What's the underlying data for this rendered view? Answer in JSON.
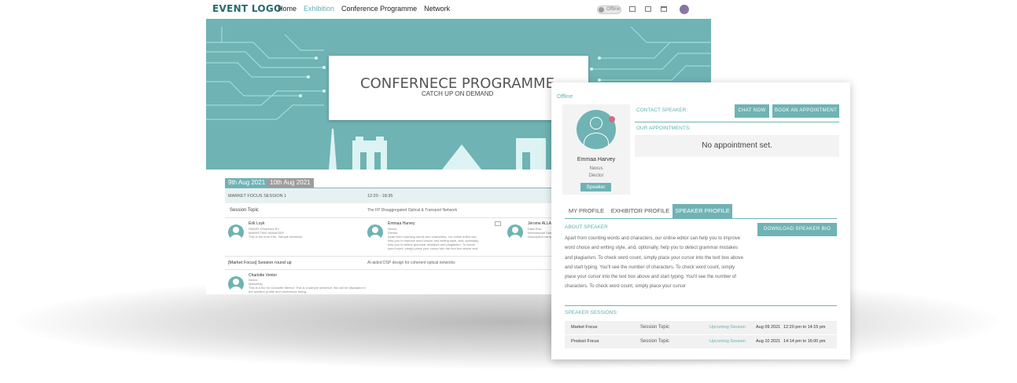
{
  "header": {
    "logo": "EVENT LOGO",
    "nav": [
      "Home",
      "Exhibition",
      "Conference Programme",
      "Network"
    ],
    "status_toggle": "Offline"
  },
  "hero": {
    "title": "CONFERNECE PROGRAMME",
    "subtitle": "CATCH UP ON DEMAND"
  },
  "schedule": {
    "dates": [
      "9th Aug 2021",
      "10th Aug 2021"
    ],
    "session1": {
      "title": "MARKET FOCUS SESSION 1",
      "time": "12:20 - 18:35",
      "topic_label": "Session Topic",
      "topic": "The FP Disaggregated Optical & Transport Network",
      "speakers": [
        {
          "name": "Erik Loyk",
          "company": "SMART Photonics BV",
          "role": "MARKETING MANAGER",
          "bio": "This is bio from Erik. Sample sentence."
        },
        {
          "name": "Emmaa Harvey",
          "company": "Nexus",
          "role": "Diector",
          "bio": "Apart from counting words and characters, our online editor can help you to improve word choice and writing style, and, optionally, help you to detect grammar mistakes and plagiarism. To check word count, simply place your cursor into the text box above and start typing. You'll see the number of characters."
        },
        {
          "name": "Jerome ALLANO",
          "company": "Data Rise",
          "role": "International Sales",
          "bio": "Description sample"
        }
      ]
    },
    "session2": {
      "title": "[Market Focus] Session round up",
      "topic": "AI-aided DSP design for coherent optical networks",
      "speaker": {
        "name": "Charlotte Ventor",
        "company": "Nexus",
        "role": "Marketing",
        "bio": "This is a bio for Charlotte Mentor. This is a sample sentence. Bio will be displayed in the speaker profile and conference listing."
      }
    }
  },
  "panel": {
    "status": "Offline",
    "profile": {
      "name": "Emmaa Harvey",
      "company": "Nexus",
      "role": "Diector",
      "badge": "Speaker"
    },
    "contact_label": "CONTACT SPEAKER:",
    "chat_button": "CHAT NOW",
    "book_button": "BOOK AN APPOINTMENT",
    "appointments_label": "OUR APPOINTMENTS:",
    "no_appointments": "No appointment set.",
    "tabs": [
      "MY PROFILE",
      "EXHIBITOR PROFILE",
      "SPEAKER PROFILE"
    ],
    "about_label": "ABOUT SPEAKER",
    "about_text": "Apart from counting words and characters, our online editor can help you to improve word choice and writing style, and, optionally, help you to detect grammar mistakes and plagiarism. To check word count, simply place your cursor into the text box above and start typing. You'll see the number of characters. To check word count, simply place your cursor into the text box above and start typing. You'll see the number of characters. To check word count, simply place your cursor",
    "download_button": "DOWNLOAD SPEAKER BIO",
    "sessions_label": "SPEAKER SESSIONS:",
    "sessions": [
      {
        "name": "Market Focus",
        "topic": "Session Topic",
        "status": "Upcoming Session",
        "date": "Aug 09 2021",
        "time": "12:20 pm to 14:15 pm"
      },
      {
        "name": "Product Focus",
        "topic": "Session Topic",
        "status": "Upcoming Session",
        "date": "Aug 10 2021",
        "time": "14:14 pm to 16:00 pm"
      }
    ]
  },
  "colors": {
    "accent": "#6fb3b4",
    "brand": "#236c6a",
    "status_dot": "#d86b7d"
  }
}
